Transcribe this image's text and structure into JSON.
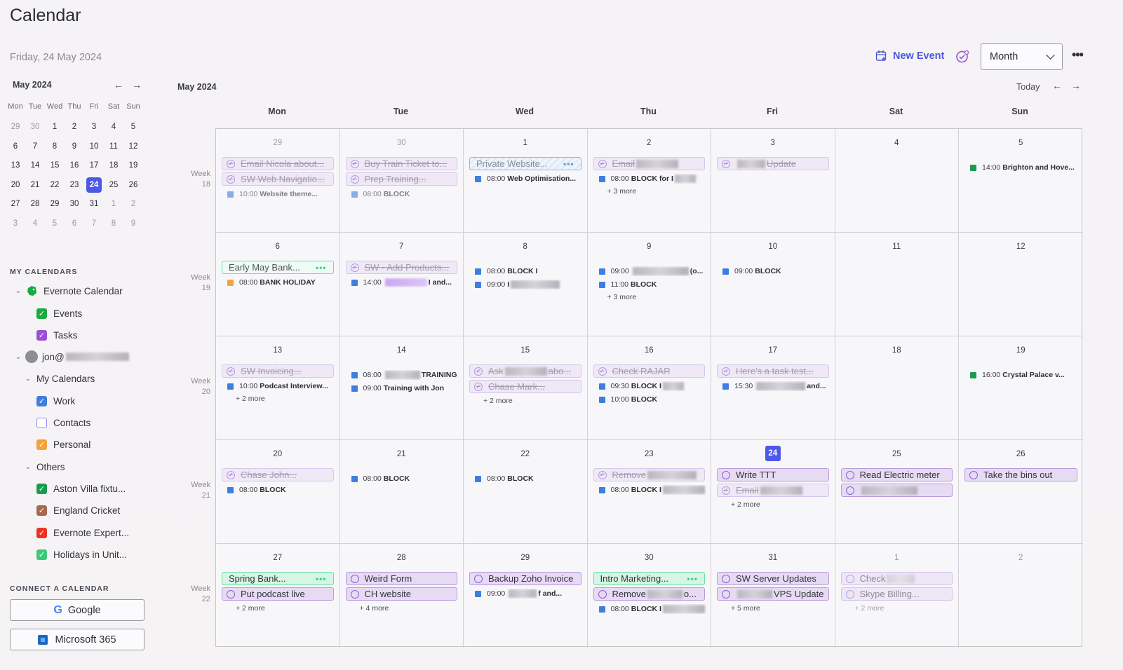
{
  "app_title": "Calendar",
  "today_label": "Friday, 24 May 2024",
  "toolbar": {
    "new_event": "New Event",
    "view": "Month",
    "more": "•••",
    "today": "Today"
  },
  "mini_calendar": {
    "month": "May 2024",
    "weekdays": [
      "Mon",
      "Tue",
      "Wed",
      "Thu",
      "Fri",
      "Sat",
      "Sun"
    ],
    "weeks": [
      [
        "29",
        "30",
        "1",
        "2",
        "3",
        "4",
        "5"
      ],
      [
        "6",
        "7",
        "8",
        "9",
        "10",
        "11",
        "12"
      ],
      [
        "13",
        "14",
        "15",
        "16",
        "17",
        "18",
        "19"
      ],
      [
        "20",
        "21",
        "22",
        "23",
        "24",
        "25",
        "26"
      ],
      [
        "27",
        "28",
        "29",
        "30",
        "31",
        "1",
        "2"
      ],
      [
        "3",
        "4",
        "5",
        "6",
        "7",
        "8",
        "9"
      ]
    ],
    "selected": "24"
  },
  "sidebar": {
    "my_calendars_title": "MY CALENDARS",
    "evernote": "Evernote Calendar",
    "events": "Events",
    "tasks": "Tasks",
    "account": "jon@",
    "my_calendars": "My Calendars",
    "work": "Work",
    "contacts": "Contacts",
    "personal": "Personal",
    "others": "Others",
    "aston": "Aston Villa fixtu...",
    "england": "England Cricket",
    "expert": "Evernote Expert...",
    "holidays": "Holidays in Unit...",
    "connect_title": "CONNECT A CALENDAR",
    "google": "Google",
    "microsoft": "Microsoft 365"
  },
  "colors": {
    "events": "#1aab3f",
    "tasks": "#9a4fd8",
    "work": "#3f7ee0",
    "personal": "#f5a13c",
    "aston": "#1a9c4e",
    "england": "#a6684f",
    "expert": "#ec3323",
    "holidays": "#3ec77a",
    "accent": "#4b58e8"
  },
  "grid": {
    "month": "May 2024",
    "weekdays": [
      "Mon",
      "Tue",
      "Wed",
      "Thu",
      "Fri",
      "Sat",
      "Sun"
    ],
    "weeks": [
      {
        "label": "Week 18",
        "days": [
          {
            "n": "29",
            "dim": true,
            "items": [
              {
                "k": "task",
                "done": true,
                "t": "Email Nicola about..."
              },
              {
                "k": "task",
                "done": true,
                "t": "SW Web Navigatio..."
              },
              {
                "k": "ev",
                "c": "#3f7ee0",
                "tm": "10:00",
                "ti": "Website theme...",
                "faded": true
              }
            ]
          },
          {
            "n": "30",
            "dim": true,
            "items": [
              {
                "k": "task",
                "done": true,
                "t": "Buy Train Ticket to..."
              },
              {
                "k": "task",
                "done": true,
                "t": "Prep Training..."
              },
              {
                "k": "ev",
                "c": "#3f7ee0",
                "tm": "08:00",
                "ti": "BLOCK",
                "faded": true
              }
            ]
          },
          {
            "n": "1",
            "items": [
              {
                "k": "allday",
                "style": "hatched",
                "t": "Private Website..."
              },
              {
                "k": "ev",
                "c": "#3f7ee0",
                "tm": "08:00",
                "ti": "Web Optimisation..."
              }
            ]
          },
          {
            "n": "2",
            "items": [
              {
                "k": "task",
                "done": true,
                "t": "Email",
                "blur": 60
              },
              {
                "k": "ev",
                "c": "#3f7ee0",
                "tm": "08:00",
                "ti": "BLOCK for I",
                "blur": 30
              },
              {
                "k": "more",
                "t": "+ 3 more"
              }
            ]
          },
          {
            "n": "3",
            "items": [
              {
                "k": "task",
                "done": true,
                "t": "Update",
                "blurPre": 40
              }
            ]
          },
          {
            "n": "4",
            "items": []
          },
          {
            "n": "5",
            "items": [
              {
                "k": "ev",
                "c": "#1a9c4e",
                "tm": "14:00",
                "ti": "Brighton and Hove..."
              }
            ]
          }
        ]
      },
      {
        "label": "Week 19",
        "days": [
          {
            "n": "6",
            "items": [
              {
                "k": "allday",
                "style": "light",
                "t": "Early May Bank..."
              },
              {
                "k": "ev",
                "c": "#f5a13c",
                "tm": "08:00",
                "ti": "BANK HOLIDAY"
              }
            ]
          },
          {
            "n": "7",
            "items": [
              {
                "k": "task",
                "done": true,
                "t": "SW - Add Products..."
              },
              {
                "k": "ev",
                "c": "#3f7ee0",
                "tm": "14:00",
                "ti": "I and...",
                "blurPre": 60,
                "purple": true
              }
            ]
          },
          {
            "n": "8",
            "items": [
              {
                "k": "ev",
                "c": "#3f7ee0",
                "tm": "08:00",
                "ti": "BLOCK I"
              },
              {
                "k": "ev",
                "c": "#3f7ee0",
                "tm": "09:00",
                "ti": "I",
                "blur": 70
              }
            ]
          },
          {
            "n": "9",
            "items": [
              {
                "k": "ev",
                "c": "#3f7ee0",
                "tm": "09:00",
                "ti": "(o...",
                "blurPre": 80
              },
              {
                "k": "ev",
                "c": "#3f7ee0",
                "tm": "11:00",
                "ti": "BLOCK"
              },
              {
                "k": "more",
                "t": "+ 3 more"
              }
            ]
          },
          {
            "n": "10",
            "items": [
              {
                "k": "ev",
                "c": "#3f7ee0",
                "tm": "09:00",
                "ti": "BLOCK"
              }
            ]
          },
          {
            "n": "11",
            "items": []
          },
          {
            "n": "12",
            "items": []
          }
        ]
      },
      {
        "label": "Week 20",
        "days": [
          {
            "n": "13",
            "items": [
              {
                "k": "task",
                "done": true,
                "t": "SW Invoicing..."
              },
              {
                "k": "ev",
                "c": "#3f7ee0",
                "tm": "10:00",
                "ti": "Podcast Interview..."
              },
              {
                "k": "more",
                "t": "+ 2 more"
              }
            ]
          },
          {
            "n": "14",
            "items": [
              {
                "k": "ev",
                "c": "#3f7ee0",
                "tm": "08:00",
                "ti": "TRAINING",
                "blurPre": 50
              },
              {
                "k": "ev",
                "c": "#3f7ee0",
                "tm": "09:00",
                "ti": "Training with Jon"
              }
            ]
          },
          {
            "n": "15",
            "items": [
              {
                "k": "task",
                "done": true,
                "t": "abo...",
                "prefix": "Ask",
                "blurMid": 60
              },
              {
                "k": "task",
                "done": true,
                "t": "Chase Mark..."
              },
              {
                "k": "more",
                "t": "+ 2 more"
              }
            ]
          },
          {
            "n": "16",
            "items": [
              {
                "k": "task",
                "done": true,
                "t": "Check RAJAR"
              },
              {
                "k": "ev",
                "c": "#3f7ee0",
                "tm": "09:30",
                "ti": "BLOCK I",
                "blur": 30
              },
              {
                "k": "ev",
                "c": "#3f7ee0",
                "tm": "10:00",
                "ti": "BLOCK"
              }
            ]
          },
          {
            "n": "17",
            "items": [
              {
                "k": "task",
                "done": true,
                "t": "Here's a task test..."
              },
              {
                "k": "ev",
                "c": "#3f7ee0",
                "tm": "15:30",
                "ti": "and...",
                "blurPre": 70
              }
            ]
          },
          {
            "n": "18",
            "items": []
          },
          {
            "n": "19",
            "items": [
              {
                "k": "ev",
                "c": "#1a9c4e",
                "tm": "16:00",
                "ti": "Crystal Palace v..."
              }
            ]
          }
        ]
      },
      {
        "label": "Week 21",
        "days": [
          {
            "n": "20",
            "items": [
              {
                "k": "task",
                "done": true,
                "t": "Chase John..."
              },
              {
                "k": "ev",
                "c": "#3f7ee0",
                "tm": "08:00",
                "ti": "BLOCK"
              }
            ]
          },
          {
            "n": "21",
            "items": [
              {
                "k": "ev",
                "c": "#3f7ee0",
                "tm": "08:00",
                "ti": "BLOCK"
              }
            ]
          },
          {
            "n": "22",
            "items": [
              {
                "k": "ev",
                "c": "#3f7ee0",
                "tm": "08:00",
                "ti": "BLOCK"
              }
            ]
          },
          {
            "n": "23",
            "items": [
              {
                "k": "task",
                "done": true,
                "t": "Remove",
                "blur": 70
              },
              {
                "k": "ev",
                "c": "#3f7ee0",
                "tm": "08:00",
                "ti": "BLOCK I",
                "blur": 60
              }
            ]
          },
          {
            "n": "24",
            "today": true,
            "items": [
              {
                "k": "task",
                "done": false,
                "t": "Write TTT"
              },
              {
                "k": "task",
                "done": true,
                "t": "Email",
                "blur": 60
              },
              {
                "k": "more",
                "t": "+ 2 more"
              }
            ]
          },
          {
            "n": "25",
            "items": [
              {
                "k": "task",
                "done": false,
                "t": "Read Electric meter"
              },
              {
                "k": "task",
                "done": false,
                "t": "",
                "blur": 80
              }
            ]
          },
          {
            "n": "26",
            "items": [
              {
                "k": "task",
                "done": false,
                "t": "Take the bins out"
              }
            ]
          }
        ]
      },
      {
        "label": "Week 22",
        "days": [
          {
            "n": "27",
            "items": [
              {
                "k": "allday",
                "style": "green",
                "t": "Spring Bank..."
              },
              {
                "k": "task",
                "done": false,
                "t": "Put podcast live"
              },
              {
                "k": "more",
                "t": "+ 2 more"
              }
            ]
          },
          {
            "n": "28",
            "items": [
              {
                "k": "task",
                "done": false,
                "t": "Weird Form"
              },
              {
                "k": "task",
                "done": false,
                "t": "CH website"
              },
              {
                "k": "more",
                "t": "+ 4 more"
              }
            ]
          },
          {
            "n": "29",
            "items": [
              {
                "k": "task",
                "done": false,
                "t": "Backup Zoho Invoice"
              },
              {
                "k": "ev",
                "c": "#3f7ee0",
                "tm": "09:00",
                "ti": "f and...",
                "blurPre": 40
              }
            ]
          },
          {
            "n": "30",
            "items": [
              {
                "k": "allday",
                "style": "green",
                "t": "Intro Marketing..."
              },
              {
                "k": "task",
                "done": false,
                "t": "Remove",
                "blur": 50,
                "suffix": "o..."
              },
              {
                "k": "ev",
                "c": "#3f7ee0",
                "tm": "08:00",
                "ti": "BLOCK I",
                "blur": 60
              }
            ]
          },
          {
            "n": "31",
            "items": [
              {
                "k": "task",
                "done": false,
                "t": "SW Server Updates"
              },
              {
                "k": "task",
                "done": false,
                "t": "VPS Update",
                "blurPre": 50
              },
              {
                "k": "more",
                "t": "+ 5 more"
              }
            ]
          },
          {
            "n": "1",
            "dim": true,
            "items": [
              {
                "k": "task",
                "done": false,
                "t": "Check",
                "blur": 40,
                "faded": true
              },
              {
                "k": "task",
                "done": false,
                "t": "Skype Billing...",
                "faded": true
              },
              {
                "k": "more",
                "t": "+ 2 more",
                "faded": true
              }
            ]
          },
          {
            "n": "2",
            "dim": true,
            "items": []
          }
        ]
      }
    ]
  }
}
